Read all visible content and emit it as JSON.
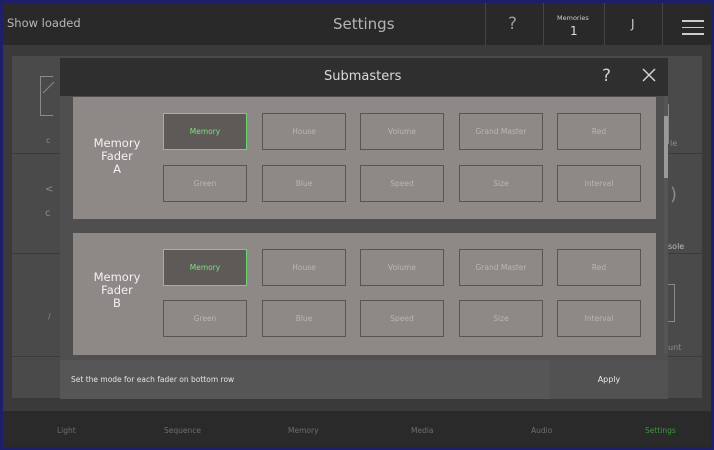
{
  "topbar": {
    "status": "Show loaded",
    "title": "Settings",
    "help_glyph": "?",
    "memories_label": "Memories",
    "memories_value": "1",
    "user_initial": "J"
  },
  "background": {
    "labels": [
      "le",
      "sole",
      "unt"
    ]
  },
  "modal": {
    "title": "Submasters",
    "help_glyph": "?",
    "sections": [
      {
        "label": [
          "Memory",
          "Fader",
          "A"
        ],
        "buttons": [
          "Memory",
          "House",
          "Volume",
          "Grand Master",
          "Red",
          "Green",
          "Blue",
          "Speed",
          "Size",
          "Interval"
        ],
        "selected": "Memory"
      },
      {
        "label": [
          "Memory",
          "Fader",
          "B"
        ],
        "buttons": [
          "Memory",
          "House",
          "Volume",
          "Grand Master",
          "Red",
          "Green",
          "Blue",
          "Speed",
          "Size",
          "Interval"
        ],
        "selected": "Memory"
      }
    ],
    "footer_text": "Set the mode for each fader on bottom row",
    "apply_label": "Apply"
  },
  "tabs": [
    {
      "label": "Light",
      "active": false
    },
    {
      "label": "Sequence",
      "active": false
    },
    {
      "label": "Memory",
      "active": false
    },
    {
      "label": "Media",
      "active": false
    },
    {
      "label": "Audio",
      "active": false
    },
    {
      "label": "Settings",
      "active": true
    }
  ],
  "colors": {
    "accent": "#6bd66b",
    "active_tab": "#3b9a3b",
    "section_bg": "#8e8886"
  }
}
